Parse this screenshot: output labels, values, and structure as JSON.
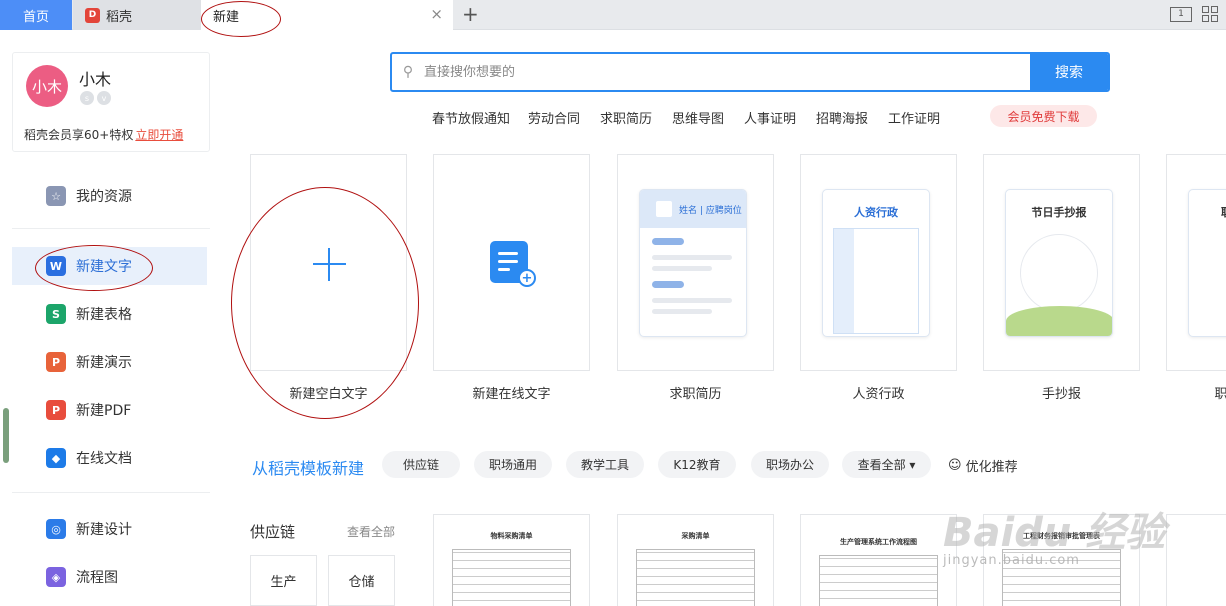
{
  "tabs": {
    "home": "首页",
    "daoke": "稻壳",
    "daoke_logo": "D",
    "new": "新建",
    "close": "×",
    "plus": "+"
  },
  "toolbar": {
    "page_indicator": "1"
  },
  "user": {
    "avatar_text": "小木",
    "name": "小木",
    "badge1": "s",
    "badge2": "v",
    "vip_text": "稻壳会员享60+特权",
    "vip_link": "立即开通"
  },
  "sidebar": {
    "items": [
      {
        "label": "我的资源",
        "icon": "star-icon",
        "color": "#8a96b3",
        "glyph": "☆"
      },
      {
        "label": "新建文字",
        "icon": "word-icon",
        "color": "#2b6fe0",
        "glyph": "W"
      },
      {
        "label": "新建表格",
        "icon": "sheet-icon",
        "color": "#1ca56a",
        "glyph": "S"
      },
      {
        "label": "新建演示",
        "icon": "slides-icon",
        "color": "#e8633a",
        "glyph": "P"
      },
      {
        "label": "新建PDF",
        "icon": "pdf-icon",
        "color": "#e84d3d",
        "glyph": "P"
      },
      {
        "label": "在线文档",
        "icon": "cloud-doc-icon",
        "color": "#1d7be8",
        "glyph": "◆"
      },
      {
        "label": "新建设计",
        "icon": "design-icon",
        "color": "#2b7be8",
        "glyph": "◎"
      },
      {
        "label": "流程图",
        "icon": "flowchart-icon",
        "color": "#7b63e0",
        "glyph": "◈"
      }
    ]
  },
  "search": {
    "placeholder": "直接搜你想要的",
    "button": "搜索",
    "hot": [
      "春节放假通知",
      "劳动合同",
      "求职简历",
      "思维导图",
      "人事证明",
      "招聘海报",
      "工作证明"
    ],
    "member": "会员免费下载"
  },
  "cards": [
    {
      "label": "新建空白文字"
    },
    {
      "label": "新建在线文字"
    },
    {
      "label": "求职简历",
      "preview": "姓名 | 应聘岗位"
    },
    {
      "label": "人资行政",
      "preview": "人资行政"
    },
    {
      "label": "手抄报",
      "preview": "节日手抄报"
    },
    {
      "label": "职",
      "preview": "职"
    }
  ],
  "templates": {
    "title": "从稻壳模板新建",
    "chips": [
      "供应链",
      "职场通用",
      "教学工具",
      "K12教育",
      "职场办公",
      "查看全部 ▾"
    ],
    "recommend": "优化推荐",
    "section": "供应链",
    "see_all": "查看全部",
    "categories": [
      "生产",
      "仓储"
    ],
    "previews": [
      "物料采购清单",
      "采购清单",
      "生产管理系统工作流程图",
      "工程财务报销审批管理表"
    ]
  },
  "watermark": {
    "brand": "Baidu 经验",
    "url": "jingyan.baidu.com"
  }
}
